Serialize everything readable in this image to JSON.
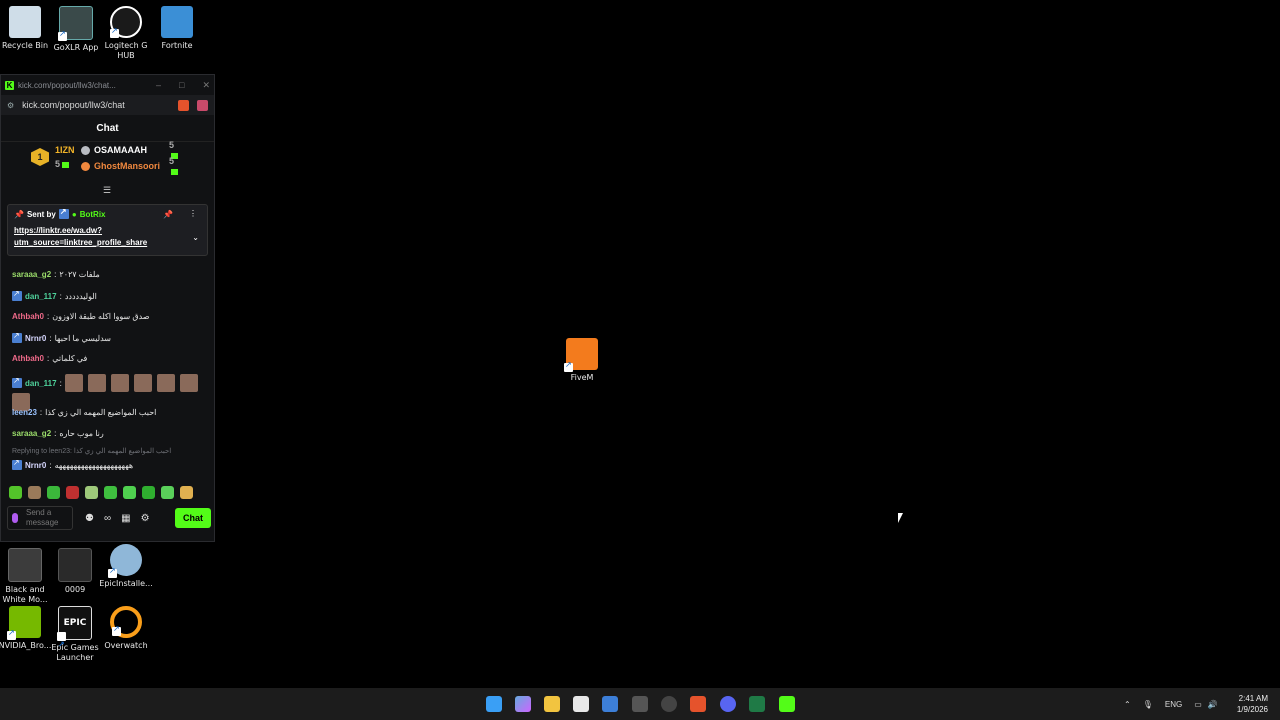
{
  "desktop_icons_top": [
    {
      "label": "Recycle Bin",
      "icon": "recycle-bin-icon",
      "color": "#d9e6f2"
    },
    {
      "label": "GoXLR App",
      "icon": "goxlr-icon",
      "color": "#3a4a4a"
    },
    {
      "label": "Logitech G HUB",
      "icon": "logitech-g-icon",
      "color": "#2a2a2a"
    },
    {
      "label": "Fortnite",
      "icon": "fortnite-icon",
      "color": "#3b8fd6"
    }
  ],
  "desktop_icons_bottom": [
    {
      "label": "Black and White Mo...",
      "icon": "video-file-icon",
      "color": "#444"
    },
    {
      "label": "0009",
      "icon": "video-file-icon",
      "color": "#333"
    },
    {
      "label": "EpicInstalle...",
      "icon": "disc-installer-icon",
      "color": "#8fb7d8"
    },
    {
      "label": "NVIDIA_Bro...",
      "icon": "nvidia-icon",
      "color": "#76b900"
    },
    {
      "label": "Epic Games Launcher",
      "icon": "epic-games-icon",
      "color": "#222"
    },
    {
      "label": "Overwatch",
      "icon": "overwatch-icon",
      "color": "#f99e1a"
    }
  ],
  "fivem": {
    "label": "FiveM",
    "icon": "fivem-icon",
    "color": "#f37b1d"
  },
  "popup": {
    "tab_title": "kick.com/popout/llw3/chat...",
    "url": "kick.com/popout/llw3/chat",
    "chat_header": "Chat",
    "leaderboard": {
      "first": {
        "rank": "1",
        "name": "1IZN",
        "count": "5"
      },
      "others": [
        {
          "name": "OSAMAAAH",
          "count": "5",
          "color": "#ffffff"
        },
        {
          "name": "GhostMansoori",
          "count": "5",
          "color": "#f0883e"
        }
      ]
    },
    "pinned": {
      "sent_by": "Sent by",
      "bot": "BotRix",
      "link": "https://linktr.ee/wa.dw?utm_source=linktree_profile_share"
    },
    "messages": [
      {
        "user": "saraaa_g2",
        "color": "#9bdc6a",
        "text": "ملفات ٢٠٢٧",
        "badge": false
      },
      {
        "user": "dan_117",
        "color": "#4fd39c",
        "text": "الوليددددد",
        "badge": true
      },
      {
        "user": "Athbah0",
        "color": "#f06a8a",
        "text": "صدق سووا اكله طبقة الاوزون",
        "badge": false
      },
      {
        "user": "Nrnr0",
        "color": "#d7d7ff",
        "text": "سدليسي ما احبها",
        "badge": true
      },
      {
        "user": "Athbah0",
        "color": "#f06a8a",
        "text": "في كلماتي",
        "badge": false
      },
      {
        "user": "dan_117",
        "color": "#4fd39c",
        "text": "",
        "badge": true
      },
      {
        "user": "leen23",
        "color": "#9bc3ff",
        "text": "احبب المواضيع المهمه الي زي كذا",
        "badge": false
      },
      {
        "user": "saraaa_g2",
        "color": "#9bdc6a",
        "text": "رنا موب حاره",
        "badge": false
      },
      {
        "user": "Nrnr0",
        "color": "#d7d7ff",
        "text": "ههههههههههههههههههههه",
        "badge": true
      }
    ],
    "reply_to": "Replying to leen23: احبب المواضيع المهمه الي زي كذا",
    "input_placeholder": "Send a message",
    "chat_button": "Chat"
  },
  "taskbar": {
    "lang": "ENG",
    "time": "2:41 AM",
    "date": "1/9/2026"
  }
}
